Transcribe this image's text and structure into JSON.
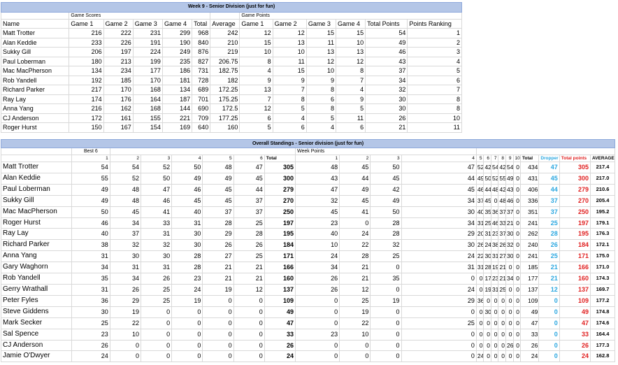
{
  "weekly": {
    "title": "Week 9 - Senior Division (just for fun)",
    "group_scores": "Game Scores",
    "group_points": "Game Points",
    "headers": [
      "Name",
      "Game 1",
      "Game 2",
      "Game 3",
      "Game 4",
      "Total",
      "Average",
      "Game 1",
      "Game 2",
      "Game 3",
      "Game 4",
      "Total Points",
      "Points Ranking"
    ],
    "rows": [
      [
        "Matt Trotter",
        "216",
        "222",
        "231",
        "299",
        "968",
        "242",
        "12",
        "12",
        "15",
        "15",
        "54",
        "1"
      ],
      [
        "Alan Keddie",
        "233",
        "226",
        "191",
        "190",
        "840",
        "210",
        "15",
        "13",
        "11",
        "10",
        "49",
        "2"
      ],
      [
        "Sukky Gill",
        "206",
        "197",
        "224",
        "249",
        "876",
        "219",
        "10",
        "10",
        "13",
        "13",
        "46",
        "3"
      ],
      [
        "Paul Loberman",
        "180",
        "213",
        "199",
        "235",
        "827",
        "206.75",
        "8",
        "11",
        "12",
        "12",
        "43",
        "4"
      ],
      [
        "Mac MacPherson",
        "134",
        "234",
        "177",
        "186",
        "731",
        "182.75",
        "4",
        "15",
        "10",
        "8",
        "37",
        "5"
      ],
      [
        "Rob Yandell",
        "192",
        "185",
        "170",
        "181",
        "728",
        "182",
        "9",
        "9",
        "9",
        "7",
        "34",
        "6"
      ],
      [
        "Richard Parker",
        "217",
        "170",
        "168",
        "134",
        "689",
        "172.25",
        "13",
        "7",
        "8",
        "4",
        "32",
        "7"
      ],
      [
        "Ray Lay",
        "174",
        "176",
        "164",
        "187",
        "701",
        "175.25",
        "7",
        "8",
        "6",
        "9",
        "30",
        "8"
      ],
      [
        "Anna Yang",
        "216",
        "162",
        "168",
        "144",
        "690",
        "172.5",
        "12",
        "5",
        "8",
        "5",
        "30",
        "8"
      ],
      [
        "CJ Anderson",
        "172",
        "161",
        "155",
        "221",
        "709",
        "177.25",
        "6",
        "4",
        "5",
        "11",
        "26",
        "10"
      ],
      [
        "Roger Hurst",
        "150",
        "167",
        "154",
        "169",
        "640",
        "160",
        "5",
        "6",
        "4",
        "6",
        "21",
        "11"
      ]
    ]
  },
  "overall": {
    "title": "Overall Standings  - Senior division (just for fun)",
    "best6": "Best 6",
    "week_points": "Week Points",
    "col_headers": [
      "",
      "1",
      "2",
      "3",
      "4",
      "5",
      "6",
      "Total",
      "1",
      "2",
      "3",
      "4",
      "5",
      "6",
      "7",
      "8",
      "9",
      "10",
      "Total",
      "Dropper",
      "Total points",
      "AVERAGE"
    ],
    "rows": [
      [
        "Matt Trotter",
        "54",
        "54",
        "52",
        "50",
        "48",
        "47",
        "305",
        "48",
        "45",
        "50",
        "47",
        "52",
        "42",
        "54",
        "42",
        "54",
        "0",
        "434",
        "47",
        "305",
        "217.4"
      ],
      [
        "Alan Keddie",
        "55",
        "52",
        "50",
        "49",
        "49",
        "45",
        "300",
        "43",
        "44",
        "45",
        "44",
        "49",
        "50",
        "52",
        "55",
        "49",
        "0",
        "431",
        "45",
        "300",
        "217.0"
      ],
      [
        "Paul Loberman",
        "49",
        "48",
        "47",
        "46",
        "45",
        "44",
        "279",
        "47",
        "49",
        "42",
        "45",
        "46",
        "44",
        "48",
        "42",
        "43",
        "0",
        "406",
        "44",
        "279",
        "210.6"
      ],
      [
        "Sukky Gill",
        "49",
        "48",
        "46",
        "45",
        "45",
        "37",
        "270",
        "32",
        "45",
        "49",
        "34",
        "37",
        "45",
        "0",
        "48",
        "46",
        "0",
        "336",
        "37",
        "270",
        "205.4"
      ],
      [
        "Mac MacPherson",
        "50",
        "45",
        "41",
        "40",
        "37",
        "37",
        "250",
        "45",
        "41",
        "50",
        "30",
        "40",
        "35",
        "36",
        "37",
        "37",
        "0",
        "351",
        "37",
        "250",
        "195.2"
      ],
      [
        "Roger Hurst",
        "46",
        "34",
        "33",
        "31",
        "28",
        "25",
        "197",
        "23",
        "0",
        "28",
        "34",
        "31",
        "25",
        "46",
        "33",
        "21",
        "0",
        "241",
        "25",
        "197",
        "179.1"
      ],
      [
        "Ray Lay",
        "40",
        "37",
        "31",
        "30",
        "29",
        "28",
        "195",
        "40",
        "24",
        "28",
        "29",
        "20",
        "31",
        "23",
        "37",
        "30",
        "0",
        "262",
        "28",
        "195",
        "176.3"
      ],
      [
        "Richard Parker",
        "38",
        "32",
        "32",
        "30",
        "26",
        "26",
        "184",
        "10",
        "22",
        "32",
        "30",
        "26",
        "24",
        "38",
        "26",
        "32",
        "0",
        "240",
        "26",
        "184",
        "172.1"
      ],
      [
        "Anna Yang",
        "31",
        "30",
        "30",
        "28",
        "27",
        "25",
        "171",
        "24",
        "28",
        "25",
        "24",
        "22",
        "30",
        "31",
        "27",
        "30",
        "0",
        "241",
        "25",
        "171",
        "175.0"
      ],
      [
        "Gary Waghorn",
        "34",
        "31",
        "31",
        "28",
        "21",
        "21",
        "166",
        "34",
        "21",
        "0",
        "31",
        "31",
        "28",
        "19",
        "21",
        "0",
        "0",
        "185",
        "21",
        "166",
        "171.0"
      ],
      [
        "Rob Yandell",
        "35",
        "34",
        "26",
        "23",
        "21",
        "21",
        "160",
        "26",
        "21",
        "35",
        "0",
        "0",
        "17",
        "23",
        "21",
        "34",
        "0",
        "177",
        "21",
        "160",
        "174.3"
      ],
      [
        "Gerry Wrathall",
        "31",
        "26",
        "25",
        "24",
        "19",
        "12",
        "137",
        "26",
        "12",
        "0",
        "24",
        "0",
        "19",
        "31",
        "25",
        "0",
        "0",
        "137",
        "12",
        "137",
        "169.7"
      ],
      [
        "Peter Fyles",
        "36",
        "29",
        "25",
        "19",
        "0",
        "0",
        "109",
        "0",
        "25",
        "19",
        "29",
        "36",
        "0",
        "0",
        "0",
        "0",
        "0",
        "109",
        "0",
        "109",
        "177.2"
      ],
      [
        "Steve Giddens",
        "30",
        "19",
        "0",
        "0",
        "0",
        "0",
        "49",
        "0",
        "19",
        "0",
        "0",
        "0",
        "30",
        "0",
        "0",
        "0",
        "0",
        "49",
        "0",
        "49",
        "174.8"
      ],
      [
        "Mark Secker",
        "25",
        "22",
        "0",
        "0",
        "0",
        "0",
        "47",
        "0",
        "22",
        "0",
        "25",
        "0",
        "0",
        "0",
        "0",
        "0",
        "0",
        "47",
        "0",
        "47",
        "174.6"
      ],
      [
        "Sal Spence",
        "23",
        "10",
        "0",
        "0",
        "0",
        "0",
        "33",
        "23",
        "10",
        "0",
        "0",
        "0",
        "0",
        "0",
        "0",
        "0",
        "0",
        "33",
        "0",
        "33",
        "164.4"
      ],
      [
        "CJ Anderson",
        "26",
        "0",
        "0",
        "0",
        "0",
        "0",
        "26",
        "0",
        "0",
        "0",
        "0",
        "0",
        "0",
        "0",
        "0",
        "26",
        "0",
        "26",
        "0",
        "26",
        "177.3"
      ],
      [
        "Jamie O'Dwyer",
        "24",
        "0",
        "0",
        "0",
        "0",
        "0",
        "24",
        "0",
        "0",
        "0",
        "0",
        "24",
        "0",
        "0",
        "0",
        "0",
        "0",
        "24",
        "0",
        "24",
        "162.8"
      ]
    ]
  }
}
